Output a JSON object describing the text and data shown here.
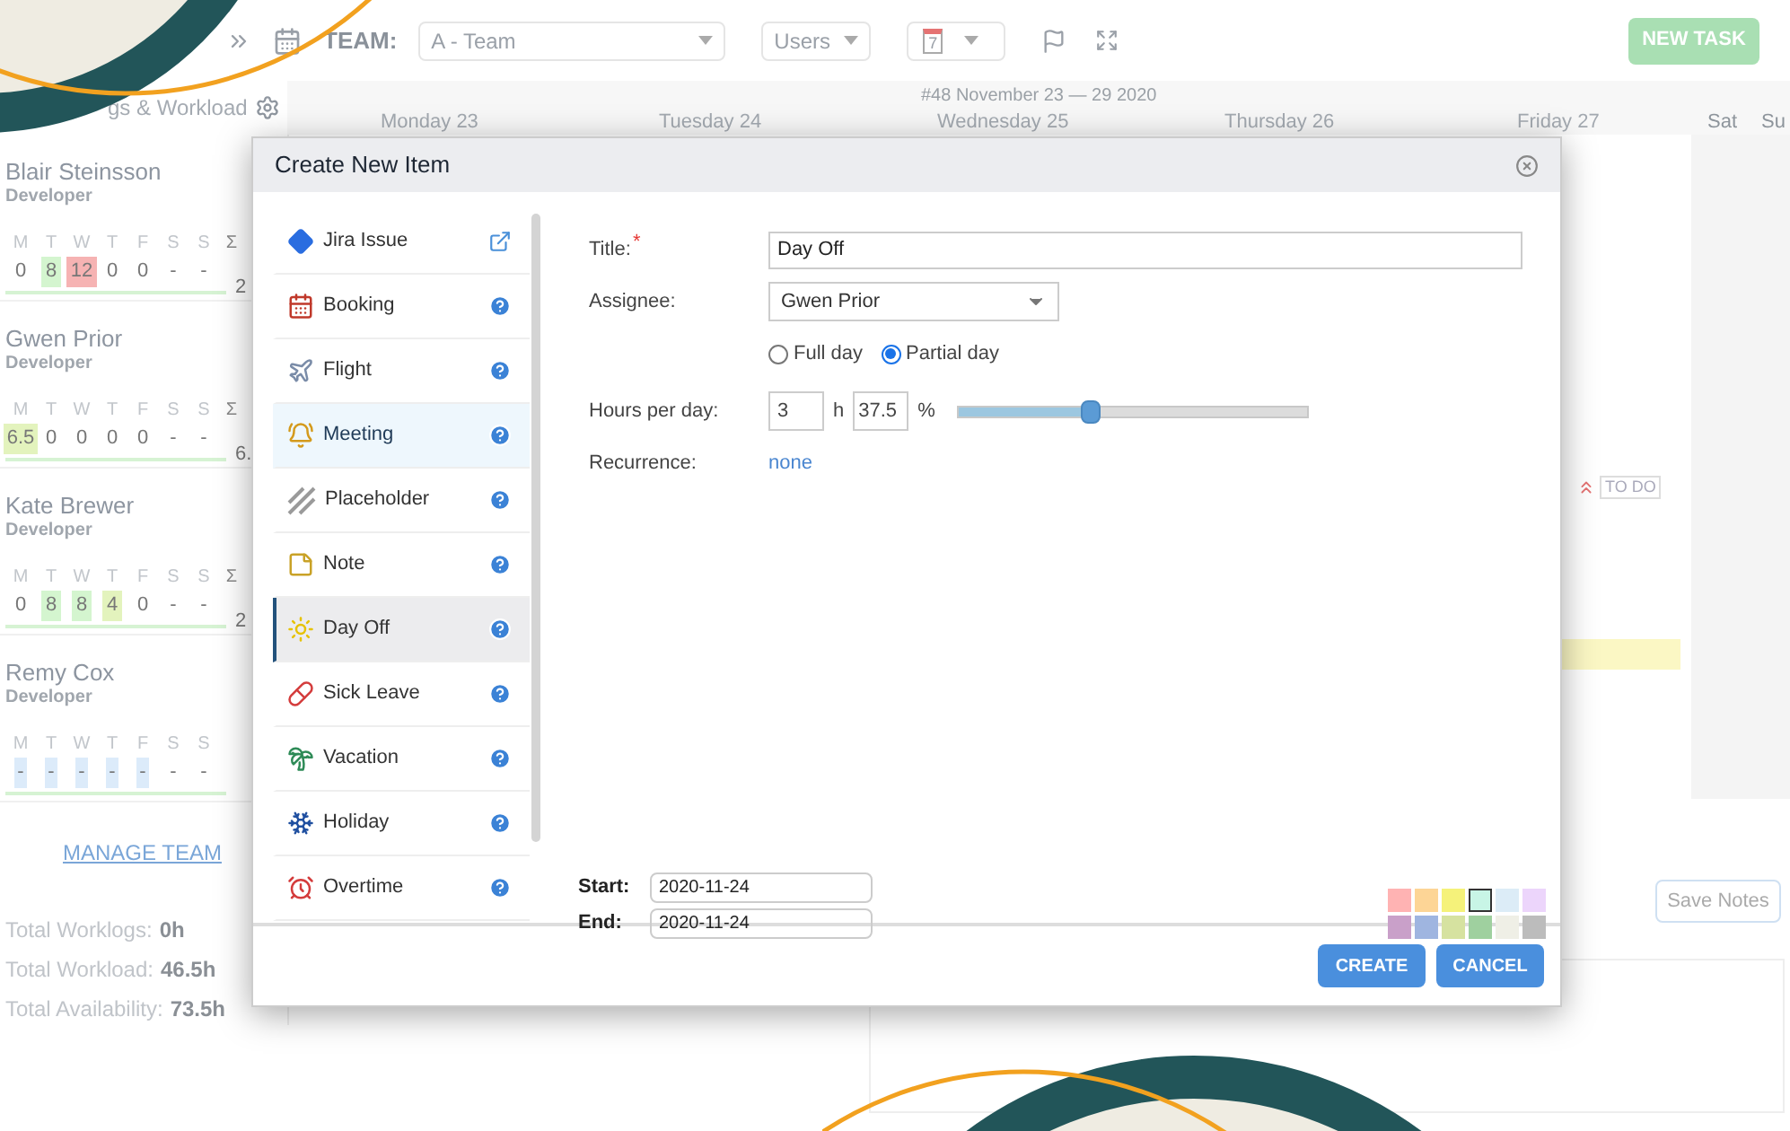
{
  "toolbar": {
    "team_label": "TEAM:",
    "team_select": "A - Team",
    "users_select": "Users",
    "date_button": "7",
    "new_task": "NEW TASK"
  },
  "sidebar": {
    "header": "gs & Workload",
    "users": [
      {
        "name": "Blair Steinsson",
        "role": "Developer",
        "sum_symbol": "Σ",
        "sum": "2",
        "day_letters": [
          "M",
          "T",
          "W",
          "T",
          "F",
          "S",
          "S"
        ],
        "days": [
          {
            "value": "0"
          },
          {
            "value": "8",
            "color": "#d4f5cf"
          },
          {
            "value": "12",
            "color": "#f6b3b3"
          },
          {
            "value": "0"
          },
          {
            "value": "0"
          },
          {
            "value": "-"
          },
          {
            "value": "-"
          }
        ]
      },
      {
        "name": "Gwen Prior",
        "role": "Developer",
        "sum_symbol": "Σ",
        "sum": "6.",
        "day_letters": [
          "M",
          "T",
          "W",
          "T",
          "F",
          "S",
          "S"
        ],
        "days": [
          {
            "value": "6.5",
            "color": "#e3f3bd"
          },
          {
            "value": "0"
          },
          {
            "value": "0"
          },
          {
            "value": "0"
          },
          {
            "value": "0"
          },
          {
            "value": "-"
          },
          {
            "value": "-"
          }
        ]
      },
      {
        "name": "Kate Brewer",
        "role": "Developer",
        "sum_symbol": "Σ",
        "sum": "2",
        "day_letters": [
          "M",
          "T",
          "W",
          "T",
          "F",
          "S",
          "S"
        ],
        "days": [
          {
            "value": "0"
          },
          {
            "value": "8",
            "color": "#d4f5cf"
          },
          {
            "value": "8",
            "color": "#d4f5cf"
          },
          {
            "value": "4",
            "color": "#e3f3bd"
          },
          {
            "value": "0"
          },
          {
            "value": "-"
          },
          {
            "value": "-"
          }
        ]
      },
      {
        "name": "Remy Cox",
        "role": "Developer",
        "day_letters": [
          "M",
          "T",
          "W",
          "T",
          "F",
          "S",
          "S"
        ],
        "days": [
          {
            "value": "-",
            "color": "#dcebfa"
          },
          {
            "value": "-",
            "color": "#dcebfa"
          },
          {
            "value": "-",
            "color": "#dcebfa"
          },
          {
            "value": "-",
            "color": "#dcebfa"
          },
          {
            "value": "-",
            "color": "#dcebfa"
          },
          {
            "value": "-"
          },
          {
            "value": "-"
          }
        ]
      }
    ],
    "manage_team": "MANAGE TEAM",
    "totals": [
      {
        "label": "Total Worklogs:",
        "value": "0h"
      },
      {
        "label": "Total Workload:",
        "value": "46.5h"
      },
      {
        "label": "Total Availability:",
        "value": "73.5h"
      }
    ]
  },
  "calendar": {
    "week": "#48 November 23 — 29 2020",
    "days": [
      {
        "label": "Monday 23",
        "weekend": false
      },
      {
        "label": "Tuesday 24",
        "weekend": false
      },
      {
        "label": "Wednesday 25",
        "weekend": false
      },
      {
        "label": "Thursday 26",
        "weekend": false
      },
      {
        "label": "Friday 27",
        "weekend": false
      },
      {
        "label": "Sat",
        "weekend": true
      },
      {
        "label": "Su",
        "weekend": true
      }
    ],
    "badge": "TO DO",
    "save_notes": "Save Notes"
  },
  "dialog": {
    "title": "Create New Item",
    "item_types": [
      {
        "label": "Jira Issue",
        "kind": "link",
        "selected": false,
        "hovered": false
      },
      {
        "label": "Booking",
        "kind": "help",
        "selected": false,
        "hovered": false
      },
      {
        "label": "Flight",
        "kind": "help",
        "selected": false,
        "hovered": false
      },
      {
        "label": "Meeting",
        "kind": "help",
        "selected": false,
        "hovered": true
      },
      {
        "label": "Placeholder",
        "kind": "help",
        "selected": false,
        "hovered": false
      },
      {
        "label": "Note",
        "kind": "help",
        "selected": false,
        "hovered": false
      },
      {
        "label": "Day Off",
        "kind": "help",
        "selected": true,
        "hovered": false
      },
      {
        "label": "Sick Leave",
        "kind": "help",
        "selected": false,
        "hovered": false
      },
      {
        "label": "Vacation",
        "kind": "help",
        "selected": false,
        "hovered": false
      },
      {
        "label": "Holiday",
        "kind": "help",
        "selected": false,
        "hovered": false
      },
      {
        "label": "Overtime",
        "kind": "help",
        "selected": false,
        "hovered": false
      }
    ],
    "title_label": "Title:",
    "title_required_mark": "*",
    "title_value": "Day Off",
    "assignee_label": "Assignee:",
    "assignee_value": "Gwen Prior",
    "day_options": [
      {
        "label": "Full day",
        "selected": false
      },
      {
        "label": "Partial day",
        "selected": true
      }
    ],
    "hours_label": "Hours per day:",
    "hours": "3",
    "hours_unit": "h",
    "percent": "37.5",
    "percent_unit": "%",
    "level": 0.375,
    "recurrence_label": "Recurrence:",
    "recurrence_value": "none",
    "start_label": "Start:",
    "start_value": "2020-11-24",
    "end_label": "End:",
    "end_value": "2020-11-24",
    "swatches": [
      {
        "color": "#ffb3b3",
        "selected": false
      },
      {
        "color": "#fdd596",
        "selected": false
      },
      {
        "color": "#f5f27a",
        "selected": false
      },
      {
        "color": "#c8f5e6",
        "selected": true
      },
      {
        "color": "#dcecf7",
        "selected": false
      },
      {
        "color": "#ecd5fb",
        "selected": false
      },
      {
        "color": "#c9a0c9",
        "selected": false
      },
      {
        "color": "#9fb5e0",
        "selected": false
      },
      {
        "color": "#d6e2a0",
        "selected": false
      },
      {
        "color": "#9fd09f",
        "selected": false
      },
      {
        "color": "#efefe6",
        "selected": false
      },
      {
        "color": "#bcbcbc",
        "selected": false
      }
    ],
    "buttons": [
      "CREATE",
      "CANCEL"
    ]
  }
}
